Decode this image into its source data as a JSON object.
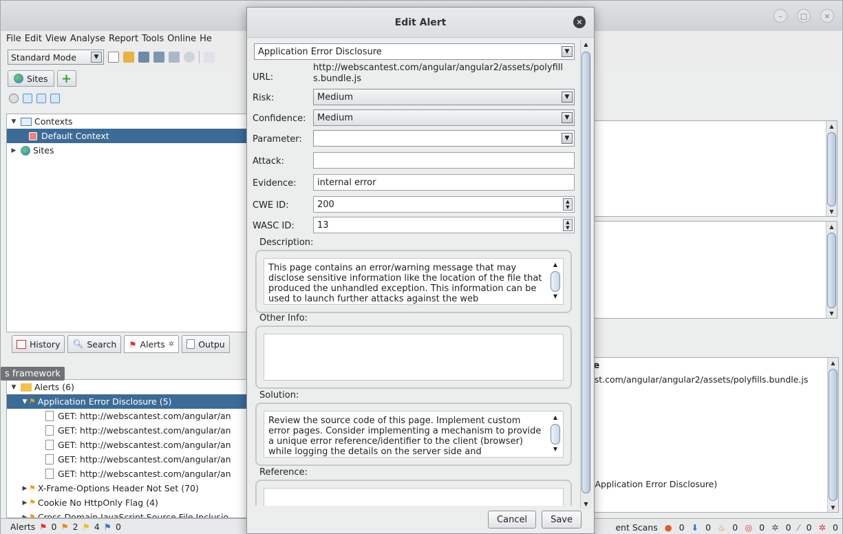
{
  "menubar": [
    "File",
    "Edit",
    "View",
    "Analyse",
    "Report",
    "Tools",
    "Online",
    "He"
  ],
  "toolbar": {
    "mode": "Standard Mode"
  },
  "tabs": {
    "sites": "Sites"
  },
  "sites_tree": {
    "contexts": "Contexts",
    "default_context": "Default Context",
    "sites": "Sites"
  },
  "bottom_tabs": {
    "history": "History",
    "search": "Search",
    "alerts": "Alerts",
    "output": "Outpu"
  },
  "tooltip": "s framework",
  "alerts_tree": {
    "root": "Alerts (6)",
    "selected": "Application Error Disclosure (5)",
    "children": [
      "GET: http://webscantest.com/angular/an",
      "GET: http://webscantest.com/angular/an",
      "GET: http://webscantest.com/angular/an",
      "GET: http://webscantest.com/angular/an",
      "GET: http://webscantest.com/angular/an"
    ],
    "others": [
      "X-Frame-Options Header Not Set (70)",
      "Cookie No HttpOnly Flag (4)",
      "Cross-Domain JavaScript Source File Inclusio"
    ]
  },
  "status": {
    "alerts_label": "Alerts",
    "counts": [
      "0",
      "2",
      "4",
      "0"
    ],
    "right_label": "ent Scans",
    "right_counts": [
      "0",
      "0",
      "0",
      "0",
      "0",
      "0",
      "0"
    ]
  },
  "right_detail": {
    "title": "re",
    "url": "est.com/angular/angular2/assets/polyfills.bundle.js",
    "footer": "- Application Error Disclosure)"
  },
  "dialog": {
    "title": "Edit Alert",
    "alert_name": "Application Error Disclosure",
    "url_label": "URL:",
    "url_value": "http://webscantest.com/angular/angular2/assets/polyfill",
    "url_value2": "s.bundle.js",
    "risk_label": "Risk:",
    "risk": "Medium",
    "confidence_label": "Confidence:",
    "confidence": "Medium",
    "parameter_label": "Parameter:",
    "parameter": "",
    "attack_label": "Attack:",
    "attack": "",
    "evidence_label": "Evidence:",
    "evidence": "internal error",
    "cwe_label": "CWE ID:",
    "cwe": "200",
    "wasc_label": "WASC ID:",
    "wasc": "13",
    "description_label": "Description:",
    "description": "This page contains an error/warning message that may disclose sensitive information like the location of the file that produced the unhandled exception. This information can be used to launch further attacks against the web",
    "other_info_label": "Other Info:",
    "other_info": "",
    "solution_label": "Solution:",
    "solution": "Review the source code of this page. Implement custom error pages. Consider implementing a mechanism to provide a unique error reference/identifier to the client (browser) while logging the details on the server side and",
    "reference_label": "Reference:",
    "cancel": "Cancel",
    "save": "Save"
  }
}
